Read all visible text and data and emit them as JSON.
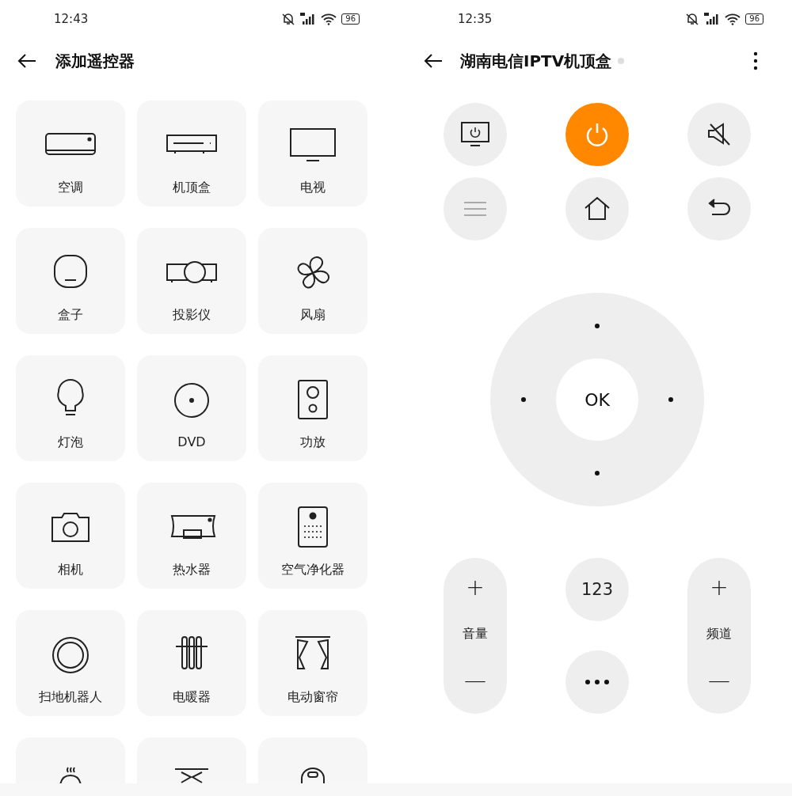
{
  "left_screen": {
    "status_bar": {
      "time": "12:43",
      "battery": "96"
    },
    "header": {
      "title": "添加遥控器"
    },
    "devices": [
      {
        "kind": "device",
        "label": "空调"
      },
      {
        "kind": "device",
        "label": "机顶盒"
      },
      {
        "kind": "device",
        "label": "电视"
      },
      {
        "kind": "device",
        "label": "盒子"
      },
      {
        "kind": "device",
        "label": "投影仪"
      },
      {
        "kind": "device",
        "label": "风扇"
      },
      {
        "kind": "device",
        "label": "灯泡"
      },
      {
        "kind": "device",
        "label": "DVD"
      },
      {
        "kind": "device",
        "label": "功放"
      },
      {
        "kind": "device",
        "label": "相机"
      },
      {
        "kind": "device",
        "label": "热水器"
      },
      {
        "kind": "device",
        "label": "空气净化器"
      },
      {
        "kind": "device",
        "label": "扫地机器人"
      },
      {
        "kind": "device",
        "label": "电暖器"
      },
      {
        "kind": "device",
        "label": "电动窗帘"
      },
      {
        "kind": "cut_off"
      },
      {
        "kind": "cut_off"
      },
      {
        "kind": "cut_off"
      }
    ]
  },
  "right_screen": {
    "status_bar": {
      "time": "12:35",
      "battery": "96"
    },
    "header": {
      "title": "湖南电信IPTV机顶盒"
    },
    "top_buttons": [
      {
        "highlighted": false
      },
      {
        "highlighted": true
      },
      {
        "highlighted": false
      },
      {
        "highlighted": false
      },
      {
        "highlighted": false
      },
      {
        "highlighted": false
      }
    ],
    "dpad": {
      "center_label": "OK"
    },
    "volume": {
      "plus": "+",
      "label": "音量",
      "minus": "—"
    },
    "number_button": "123",
    "channel": {
      "plus": "+",
      "label": "频道",
      "minus": "—"
    }
  }
}
